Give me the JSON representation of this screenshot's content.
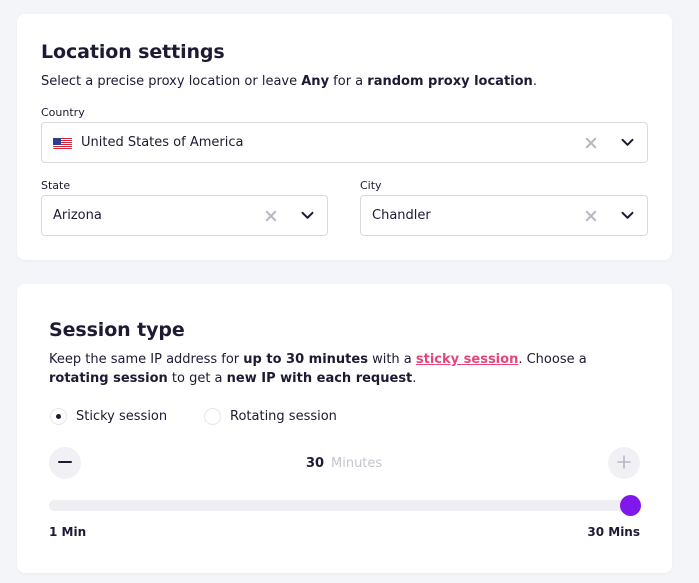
{
  "location": {
    "title": "Location settings",
    "desc": {
      "part1": "Select a precise proxy location or leave ",
      "bold1": "Any",
      "part2": " for a ",
      "bold2": "random proxy location",
      "part3": "."
    },
    "country": {
      "label": "Country",
      "value": "United States of America",
      "flag_icon": "us-flag-icon"
    },
    "state": {
      "label": "State",
      "value": "Arizona"
    },
    "city": {
      "label": "City",
      "value": "Chandler"
    }
  },
  "session": {
    "title": "Session type",
    "desc": {
      "part1": "Keep the same IP address for ",
      "bold1": "up to 30 minutes",
      "part2": " with a ",
      "link": "sticky session",
      "part3": ". Choose a ",
      "bold2": "rotating session",
      "part4": " to get a ",
      "bold3": "new IP with each request",
      "part5": "."
    },
    "options": [
      {
        "label": "Sticky session",
        "selected": true
      },
      {
        "label": "Rotating session",
        "selected": false
      }
    ],
    "stepper": {
      "value": "30",
      "unit": "Minutes"
    },
    "slider": {
      "min_label": "1 Min",
      "max_label": "30 Mins",
      "min": 1,
      "max": 30,
      "value": 30
    }
  },
  "colors": {
    "accent": "#8017ec",
    "link": "#e8447e",
    "text": "#1d1a33",
    "background": "#f4f5f9"
  }
}
